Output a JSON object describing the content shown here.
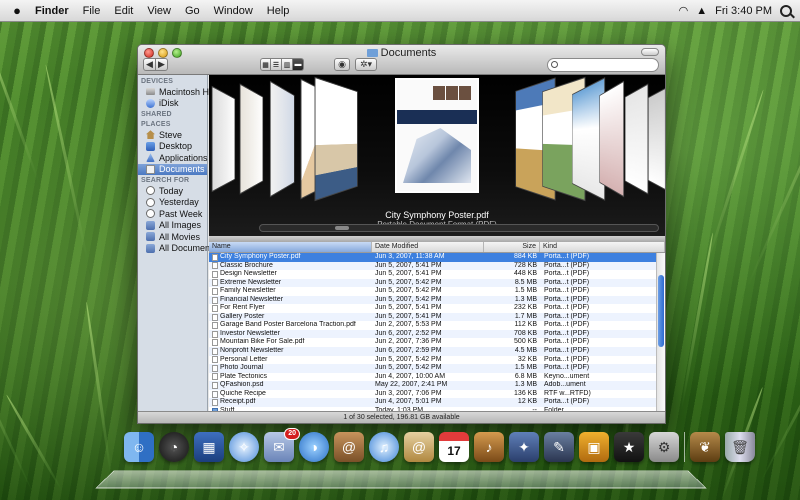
{
  "menubar": {
    "app_name": "Finder",
    "items": [
      "File",
      "Edit",
      "View",
      "Go",
      "Window",
      "Help"
    ],
    "clock": "Fri 3:40 PM"
  },
  "window": {
    "title": "Documents",
    "search_placeholder": ""
  },
  "sidebar": {
    "sections": [
      {
        "heading": "DEVICES",
        "items": [
          {
            "label": "Macintosh HD",
            "icon": "hard-drive-icon"
          },
          {
            "label": "iDisk",
            "icon": "idisk-icon"
          }
        ]
      },
      {
        "heading": "SHARED",
        "items": []
      },
      {
        "heading": "PLACES",
        "items": [
          {
            "label": "Steve",
            "icon": "home-icon"
          },
          {
            "label": "Desktop",
            "icon": "desktop-icon"
          },
          {
            "label": "Applications",
            "icon": "applications-icon"
          },
          {
            "label": "Documents",
            "icon": "documents-icon",
            "selected": true
          }
        ]
      },
      {
        "heading": "SEARCH FOR",
        "items": [
          {
            "label": "Today",
            "icon": "clock-icon"
          },
          {
            "label": "Yesterday",
            "icon": "clock-icon"
          },
          {
            "label": "Past Week",
            "icon": "clock-icon"
          },
          {
            "label": "All Images",
            "icon": "smart-folder-icon"
          },
          {
            "label": "All Movies",
            "icon": "smart-folder-icon"
          },
          {
            "label": "All Documents",
            "icon": "smart-folder-icon"
          }
        ]
      }
    ]
  },
  "coverflow": {
    "selected_name": "City Symphony Poster.pdf",
    "selected_kind": "Portable Document Format (PDF)"
  },
  "list": {
    "columns": {
      "name": "Name",
      "date": "Date Modified",
      "size": "Size",
      "kind": "Kind"
    },
    "rows": [
      {
        "name": "City Symphony Poster.pdf",
        "date": "Jun 3, 2007, 11:38 AM",
        "size": "884 KB",
        "kind": "Porta...t (PDF)",
        "selected": true
      },
      {
        "name": "Classic Brochure",
        "date": "Jun 5, 2007, 5:41 PM",
        "size": "728 KB",
        "kind": "Porta...t (PDF)"
      },
      {
        "name": "Design Newsletter",
        "date": "Jun 5, 2007, 5:41 PM",
        "size": "448 KB",
        "kind": "Porta...t (PDF)"
      },
      {
        "name": "Extreme Newsletter",
        "date": "Jun 5, 2007, 5:42 PM",
        "size": "8.5 MB",
        "kind": "Porta...t (PDF)"
      },
      {
        "name": "Family Newsletter",
        "date": "Jun 5, 2007, 5:42 PM",
        "size": "1.5 MB",
        "kind": "Porta...t (PDF)"
      },
      {
        "name": "Financial Newsletter",
        "date": "Jun 5, 2007, 5:42 PM",
        "size": "1.3 MB",
        "kind": "Porta...t (PDF)"
      },
      {
        "name": "For Rent Flyer",
        "date": "Jun 5, 2007, 5:41 PM",
        "size": "232 KB",
        "kind": "Porta...t (PDF)"
      },
      {
        "name": "Gallery Poster",
        "date": "Jun 5, 2007, 5:41 PM",
        "size": "1.7 MB",
        "kind": "Porta...t (PDF)"
      },
      {
        "name": "Garage Band Poster Barcelona Traction.pdf",
        "date": "Jun 2, 2007, 5:53 PM",
        "size": "112 KB",
        "kind": "Porta...t (PDF)"
      },
      {
        "name": "Investor Newsletter",
        "date": "Jun 6, 2007, 2:52 PM",
        "size": "708 KB",
        "kind": "Porta...t (PDF)"
      },
      {
        "name": "Mountain Bike For Sale.pdf",
        "date": "Jun 2, 2007, 7:36 PM",
        "size": "500 KB",
        "kind": "Porta...t (PDF)"
      },
      {
        "name": "Nonprofit Newsletter",
        "date": "Jun 6, 2007, 2:59 PM",
        "size": "4.5 MB",
        "kind": "Porta...t (PDF)"
      },
      {
        "name": "Personal Letter",
        "date": "Jun 5, 2007, 5:42 PM",
        "size": "32 KB",
        "kind": "Porta...t (PDF)"
      },
      {
        "name": "Photo Journal",
        "date": "Jun 5, 2007, 5:42 PM",
        "size": "1.5 MB",
        "kind": "Porta...t (PDF)"
      },
      {
        "name": "Plate Tectonics",
        "date": "Jun 4, 2007, 10:00 AM",
        "size": "6.8 MB",
        "kind": "Keyno...ument"
      },
      {
        "name": "QFashion.psd",
        "date": "May 22, 2007, 2:41 PM",
        "size": "1.3 MB",
        "kind": "Adob...ument"
      },
      {
        "name": "Quiche Recipe",
        "date": "Jun 3, 2007, 7:06 PM",
        "size": "136 KB",
        "kind": "RTF w...RTFD)"
      },
      {
        "name": "Receipt.pdf",
        "date": "Jun 4, 2007, 5:01 PM",
        "size": "12 KB",
        "kind": "Porta...t (PDF)"
      },
      {
        "name": "Stuff",
        "date": "Today, 1:03 PM",
        "size": "--",
        "kind": "Folder"
      }
    ]
  },
  "status": "1 of 30 selected, 196.81 GB available",
  "dock": {
    "mail_badge": "20",
    "ical_day": "17",
    "icons": [
      "finder-icon",
      "dashboard-icon",
      "spaces-icon",
      "safari-icon",
      "mail-icon",
      "ichat-icon",
      "address-book-icon",
      "itunes-icon",
      "mail-stamp-icon",
      "ical-icon",
      "garageband-icon",
      "automator-icon",
      "preview-icon",
      "photo-booth-icon",
      "imovie-icon",
      "system-prefs-icon",
      "butterfly-icon",
      "trash-icon"
    ]
  },
  "colors": {
    "selection": "#3d80df",
    "sidebar_bg": "#d6dde6",
    "coverflow_bg": "#000000"
  }
}
